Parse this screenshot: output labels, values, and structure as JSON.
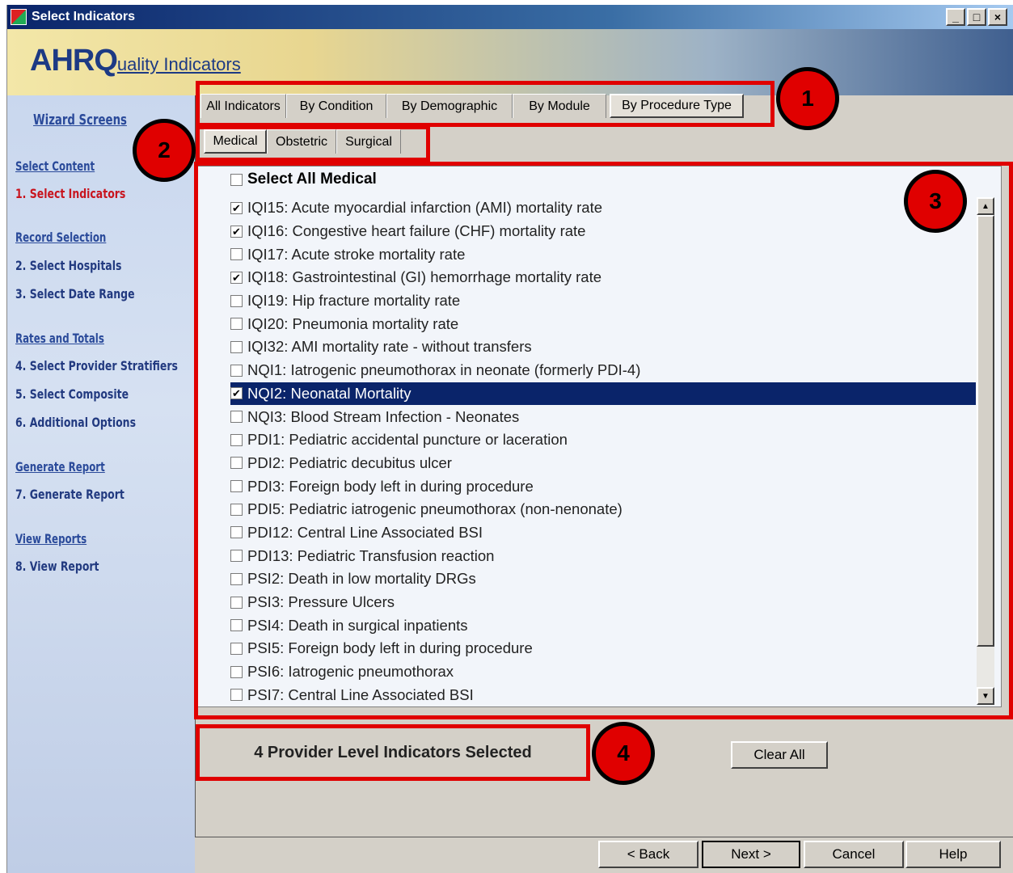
{
  "window": {
    "title": "Select Indicators",
    "controls": {
      "minimize": "_",
      "maximize": "□",
      "close": "×"
    }
  },
  "banner": {
    "logo_big": "AHRQ",
    "logo_small": "uality Indicators"
  },
  "sidebar": {
    "wizard_screens": "Wizard Screens",
    "sections": [
      {
        "header": "Select Content",
        "items": [
          "1. Select Indicators"
        ]
      },
      {
        "header": "Record Selection",
        "items": [
          "2. Select Hospitals",
          "3. Select Date Range"
        ]
      },
      {
        "header": "Rates and Totals",
        "items": [
          "4. Select Provider Stratifiers",
          "5. Select Composite",
          "6. Additional Options"
        ]
      },
      {
        "header": "Generate Report",
        "items": [
          "7. Generate Report"
        ]
      },
      {
        "header": "View Reports",
        "items": [
          "8. View Report"
        ]
      }
    ],
    "active_item": "1. Select Indicators"
  },
  "tabs_primary": [
    "All Indicators",
    "By Condition",
    "By Demographic",
    "By Module",
    "By Procedure Type"
  ],
  "tabs_primary_selected": "By Procedure Type",
  "tabs_secondary": [
    "Medical",
    "Obstetric",
    "Surgical"
  ],
  "tabs_secondary_selected": "Medical",
  "list": {
    "select_all_label": "Select All Medical",
    "select_all_checked": false,
    "items": [
      {
        "label": "IQI15: Acute myocardial infarction (AMI) mortality rate",
        "checked": true
      },
      {
        "label": "IQI16: Congestive heart failure (CHF) mortality rate",
        "checked": true
      },
      {
        "label": "IQI17: Acute stroke mortality rate",
        "checked": false
      },
      {
        "label": "IQI18: Gastrointestinal (GI) hemorrhage mortality rate",
        "checked": true
      },
      {
        "label": "IQI19: Hip fracture mortality rate",
        "checked": false
      },
      {
        "label": "IQI20: Pneumonia mortality rate",
        "checked": false
      },
      {
        "label": "IQI32: AMI mortality rate - without transfers",
        "checked": false
      },
      {
        "label": "NQI1: Iatrogenic pneumothorax in neonate (formerly PDI-4)",
        "checked": false
      },
      {
        "label": "NQI2: Neonatal Mortality",
        "checked": true,
        "highlighted": true
      },
      {
        "label": "NQI3: Blood Stream Infection - Neonates",
        "checked": false
      },
      {
        "label": "PDI1: Pediatric accidental puncture or laceration",
        "checked": false
      },
      {
        "label": "PDI2: Pediatric decubitus ulcer",
        "checked": false
      },
      {
        "label": "PDI3: Foreign body left in during procedure",
        "checked": false
      },
      {
        "label": "PDI5: Pediatric iatrogenic pneumothorax (non-nenonate)",
        "checked": false
      },
      {
        "label": "PDI12: Central Line Associated BSI",
        "checked": false
      },
      {
        "label": "PDI13: Pediatric Transfusion reaction",
        "checked": false
      },
      {
        "label": "PSI2: Death in low mortality DRGs",
        "checked": false
      },
      {
        "label": "PSI3: Pressure Ulcers",
        "checked": false
      },
      {
        "label": "PSI4: Death in surgical inpatients",
        "checked": false
      },
      {
        "label": "PSI5: Foreign body left in during procedure",
        "checked": false
      },
      {
        "label": "PSI6: Iatrogenic pneumothorax",
        "checked": false
      },
      {
        "label": "PSI7: Central Line Associated BSI",
        "checked": false
      }
    ]
  },
  "status": {
    "text": "4 Provider Level Indicators Selected"
  },
  "buttons": {
    "clear_all": "Clear All",
    "back": "< Back",
    "next": "Next >",
    "cancel": "Cancel",
    "help": "Help"
  },
  "callouts": [
    "1",
    "2",
    "3",
    "4"
  ],
  "colors": {
    "highlight_bg": "#0a246a",
    "callout_red": "#e00000",
    "active_nav": "#c8141e"
  }
}
